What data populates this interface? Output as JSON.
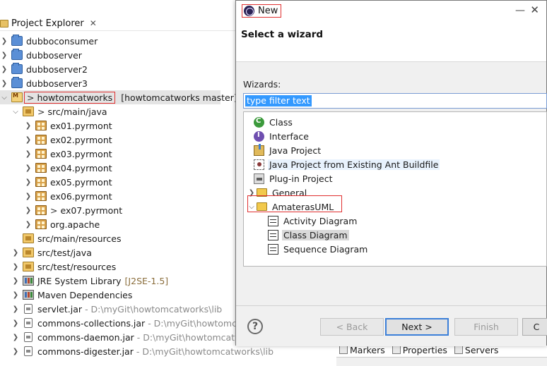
{
  "project_explorer": {
    "tab_title": "Project Explorer",
    "tab_close": "✕",
    "items": [
      {
        "name": "dubboconsumer"
      },
      {
        "name": "dubboserver"
      },
      {
        "name": "dubboserver2"
      },
      {
        "name": "dubboserver3"
      },
      {
        "prefix": ">",
        "name": "howtomcatworks",
        "decoration": "[howtomcatworks master]"
      },
      {
        "prefix": ">",
        "name": "src/main/java"
      },
      {
        "name": "ex01.pyrmont"
      },
      {
        "name": "ex02.pyrmont"
      },
      {
        "name": "ex03.pyrmont"
      },
      {
        "name": "ex04.pyrmont"
      },
      {
        "name": "ex05.pyrmont"
      },
      {
        "name": "ex06.pyrmont"
      },
      {
        "prefix": ">",
        "name": "ex07.pyrmont"
      },
      {
        "name": "org.apache"
      },
      {
        "name": "src/main/resources"
      },
      {
        "name": "src/test/java"
      },
      {
        "name": "src/test/resources"
      },
      {
        "name": "JRE System Library",
        "decoration": "[J2SE-1.5]"
      },
      {
        "name": "Maven Dependencies"
      },
      {
        "name": "servlet.jar",
        "decoration": "- D:\\myGit\\howtomcatworks\\lib"
      },
      {
        "name": "commons-collections.jar",
        "decoration": "- D:\\myGit\\howtomcatworks\\"
      },
      {
        "name": "commons-daemon.jar",
        "decoration": "- D:\\myGit\\howtomcatwor"
      },
      {
        "name": "commons-digester.jar",
        "decoration": "- D:\\myGit\\howtomcatworks\\lib"
      }
    ]
  },
  "bottom_tabs": {
    "markers": "Markers",
    "properties": "Properties",
    "servers": "Servers"
  },
  "dialog": {
    "title": "New",
    "heading": "Select a wizard",
    "wizards_label": "Wizards:",
    "filter_text": "type filter text",
    "wizards": [
      {
        "label": "Class"
      },
      {
        "label": "Interface"
      },
      {
        "label": "Java Project"
      },
      {
        "label": "Java Project from Existing Ant Buildfile"
      },
      {
        "label": "Plug-in Project"
      },
      {
        "label": "General"
      },
      {
        "label": "AmaterasUML"
      },
      {
        "label": "Activity Diagram"
      },
      {
        "label": "Class Diagram"
      },
      {
        "label": "Sequence Diagram"
      }
    ],
    "buttons": {
      "help": "?",
      "back": "< Back",
      "next": "Next >",
      "finish": "Finish",
      "cancel": "C"
    },
    "controls": {
      "minimize": "—",
      "close": "✕"
    }
  },
  "colors": {
    "annotation_red": "#e03030",
    "selection_blue": "#3399ff",
    "dialog_body": "#f0f0f0"
  }
}
